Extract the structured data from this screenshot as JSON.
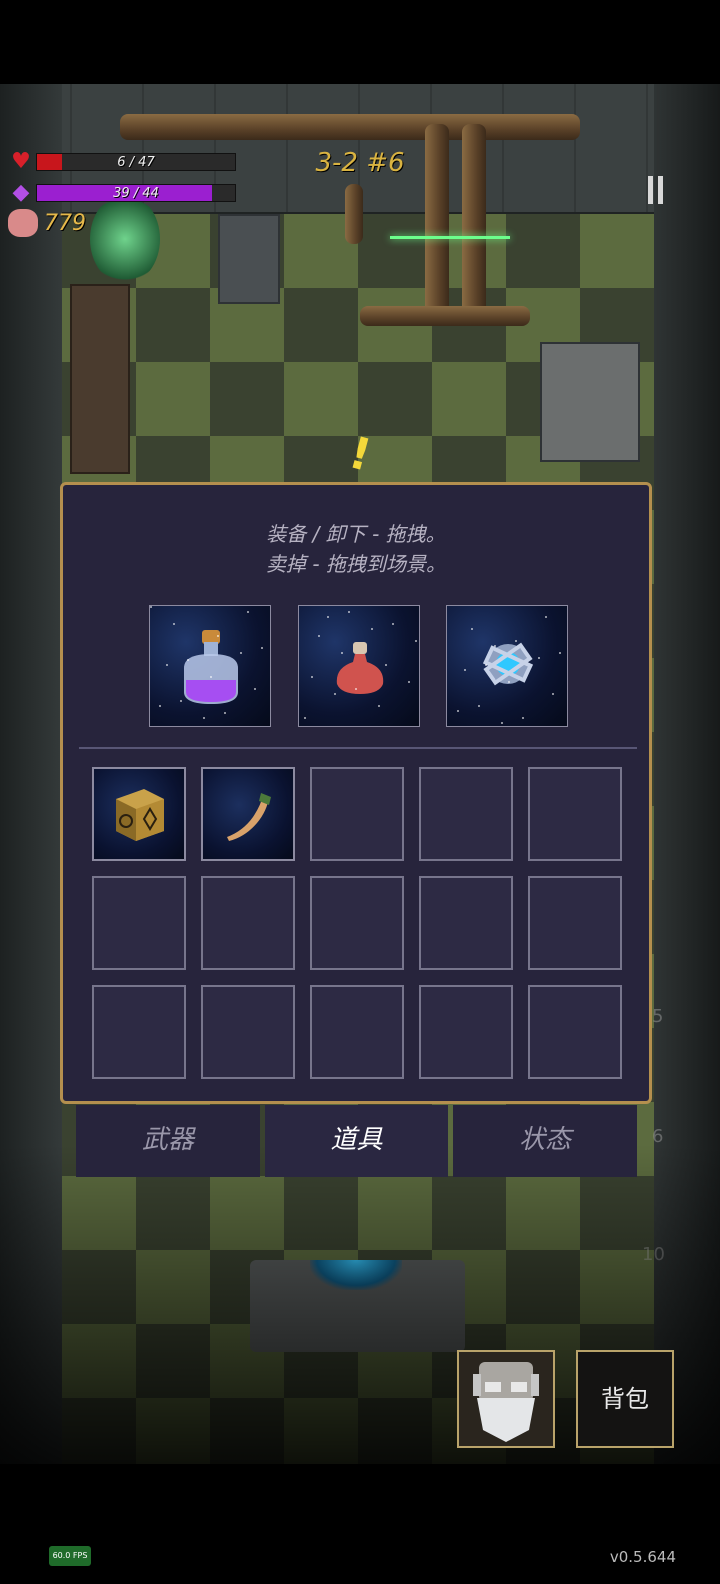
{
  "hud": {
    "hp_text": "6 / 47",
    "hp_fraction": 0.128,
    "mana_text": "39 / 44",
    "mana_fraction": 0.886,
    "gold": "779",
    "stage": "3-2 #6",
    "hp_color": "#c8161c",
    "mana_color": "#9b1fd0"
  },
  "inventory": {
    "hint_line1": "装备 / 卸下 - 拖拽。",
    "hint_line2": "卖掉 - 拖拽到场景。",
    "equipped": [
      {
        "icon": "purple-potion-icon"
      },
      {
        "icon": "red-potion-icon"
      },
      {
        "icon": "blue-orb-icon"
      }
    ],
    "bag_slots": [
      {
        "icon": "rune-cube-icon"
      },
      {
        "icon": "horn-icon"
      },
      {},
      {},
      {},
      {},
      {},
      {},
      {},
      {},
      {},
      {},
      {},
      {},
      {}
    ]
  },
  "tabs": [
    {
      "label": "武器",
      "active": false
    },
    {
      "label": "道具",
      "active": true
    },
    {
      "label": "状态",
      "active": false
    }
  ],
  "background_numbers": [
    "5",
    "6",
    "10"
  ],
  "buttons": {
    "bag_label": "背包"
  },
  "footer": {
    "fps": "60.0 FPS",
    "version": "v0.5.644"
  },
  "colors": {
    "panel_bg": "#27243c",
    "panel_border": "#b48f4e",
    "gold_text": "#d9b341"
  }
}
